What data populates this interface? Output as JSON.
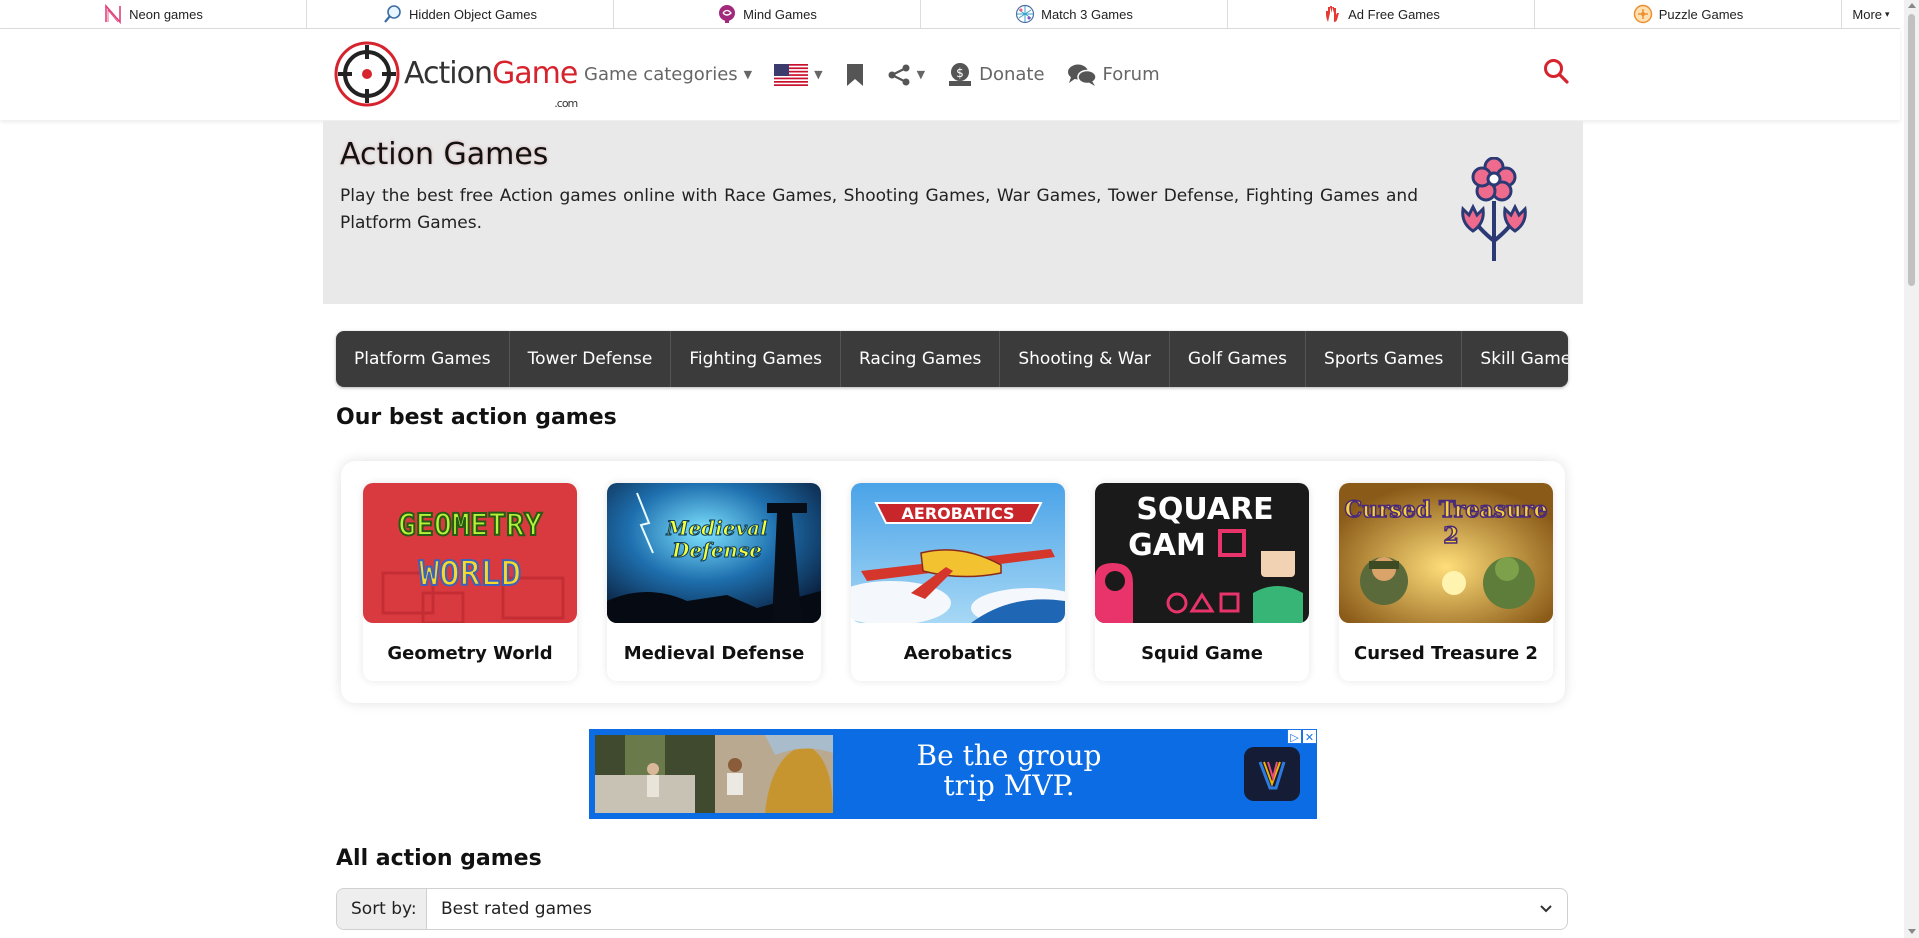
{
  "topbar": {
    "links": [
      {
        "label": "Neon games",
        "icon": "neon-n-icon"
      },
      {
        "label": "Hidden Object Games",
        "icon": "magnifier-icon"
      },
      {
        "label": "Mind Games",
        "icon": "brain-icon"
      },
      {
        "label": "Match 3 Games",
        "icon": "match3-icon"
      },
      {
        "label": "Ad Free Games",
        "icon": "hand-icon"
      },
      {
        "label": "Puzzle Games",
        "icon": "puzzle-icon"
      }
    ],
    "more_label": "More"
  },
  "header": {
    "logo": {
      "part1": "Action",
      "part2": "Game",
      "suffix": ".com"
    },
    "nav": {
      "categories_label": "Game categories",
      "donate_label": "Donate",
      "forum_label": "Forum"
    },
    "colors": {
      "brand": "#d6232e",
      "nav_text": "#666666"
    }
  },
  "hero": {
    "title": "Action Games",
    "description": "Play the best free Action games online with Race Games, Shooting Games, War Games, Tower Defense, Fighting Games and Platform Games."
  },
  "categories": [
    "Platform Games",
    "Tower Defense",
    "Fighting Games",
    "Racing Games",
    "Shooting & War",
    "Golf Games",
    "Sports Games",
    "Skill Games"
  ],
  "best": {
    "heading": "Our best action games",
    "games": [
      {
        "title": "Geometry World",
        "thumb_text": [
          "GEOMETRY",
          "WORLD"
        ]
      },
      {
        "title": "Medieval Defense",
        "thumb_text": [
          "Medieval",
          "Defense"
        ]
      },
      {
        "title": "Aerobatics",
        "thumb_text": [
          "AEROBATICS"
        ]
      },
      {
        "title": "Squid Game",
        "thumb_text": [
          "SQUARE",
          "GAM"
        ]
      },
      {
        "title": "Cursed Treasure 2",
        "thumb_text": [
          "Cursed Treasure",
          "2"
        ]
      }
    ]
  },
  "ad": {
    "text_line1": "Be the group",
    "text_line2": "trip MVP."
  },
  "all": {
    "heading": "All action games",
    "sort_label": "Sort by:",
    "sort_value": "Best rated games"
  }
}
